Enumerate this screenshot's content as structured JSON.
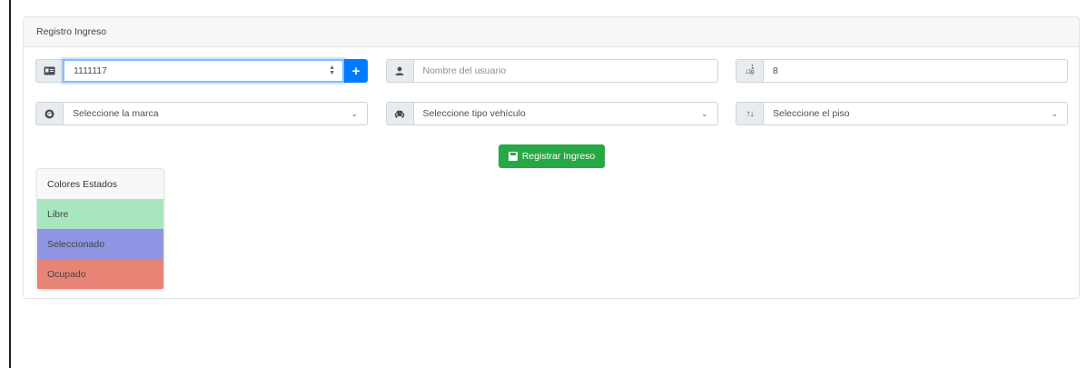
{
  "card": {
    "title": "Registro Ingreso"
  },
  "form": {
    "document_value": "1111117",
    "user_name_placeholder": "Nombre del usuario",
    "slot_value": "8",
    "brand_select": "Seleccione la marca",
    "vehicle_type_select": "Seleccione tipo vehículo",
    "floor_select": "Seleccione el piso",
    "add_label": "+",
    "submit_label": "Registrar Ingreso"
  },
  "icons": {
    "document": "id-card-icon",
    "user": "user-icon",
    "slot": "sort-numeric-icon",
    "brand": "brand-logo-icon",
    "vehicle": "car-icon",
    "floor": "sort-arrows-icon",
    "submit": "floppy-disk-icon"
  },
  "legend": {
    "title": "Colores Estados",
    "items": [
      {
        "label": "Libre",
        "color": "#a8e6bf"
      },
      {
        "label": "Seleccionado",
        "color": "#8f95e3"
      },
      {
        "label": "Ocupado",
        "color": "#e88476"
      }
    ]
  },
  "colors": {
    "primary": "#007bff",
    "success": "#28a745"
  }
}
